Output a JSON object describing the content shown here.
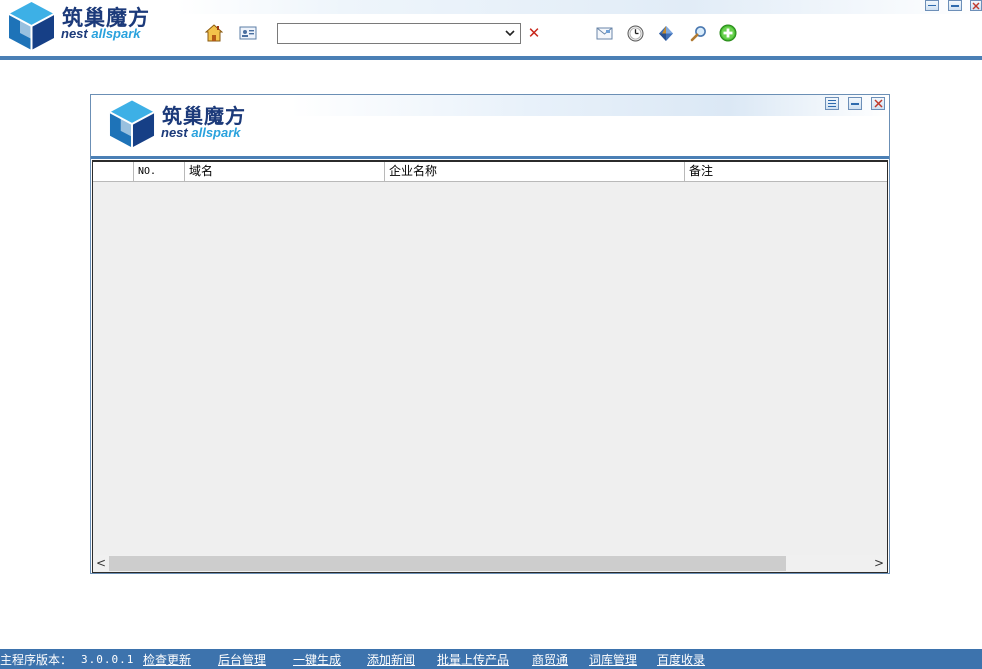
{
  "header": {
    "logo_title": "筑巢魔方",
    "logo_sub_a": "nest",
    "logo_sub_b": "allspark",
    "toolbar_icons": [
      "home-icon",
      "card-icon",
      "mail-icon",
      "clock-icon",
      "diamond-icon",
      "search-icon",
      "add-icon"
    ],
    "search_select": {
      "value": ""
    },
    "clear_label": "✕"
  },
  "window": {
    "logo_title": "筑巢魔方",
    "logo_sub_a": "nest",
    "logo_sub_b": "allspark",
    "grid": {
      "columns": [
        "",
        "NO.",
        "域名",
        "企业名称",
        "备注"
      ],
      "rows": []
    },
    "scroll": {
      "left": "<",
      "right": ">"
    }
  },
  "footer": {
    "version_label": "主程序版本：",
    "version": "3.0.0.1",
    "links": [
      "检查更新",
      "后台管理",
      "一键生成",
      "添加新闻",
      "批量上传产品",
      "商贸通",
      "词库管理",
      "百度收录"
    ]
  },
  "colors": {
    "accent": "#4a7fb5",
    "footer_bg": "#3d73ad",
    "logo_dark": "#1c3a7a",
    "logo_light": "#2aa2dd"
  }
}
